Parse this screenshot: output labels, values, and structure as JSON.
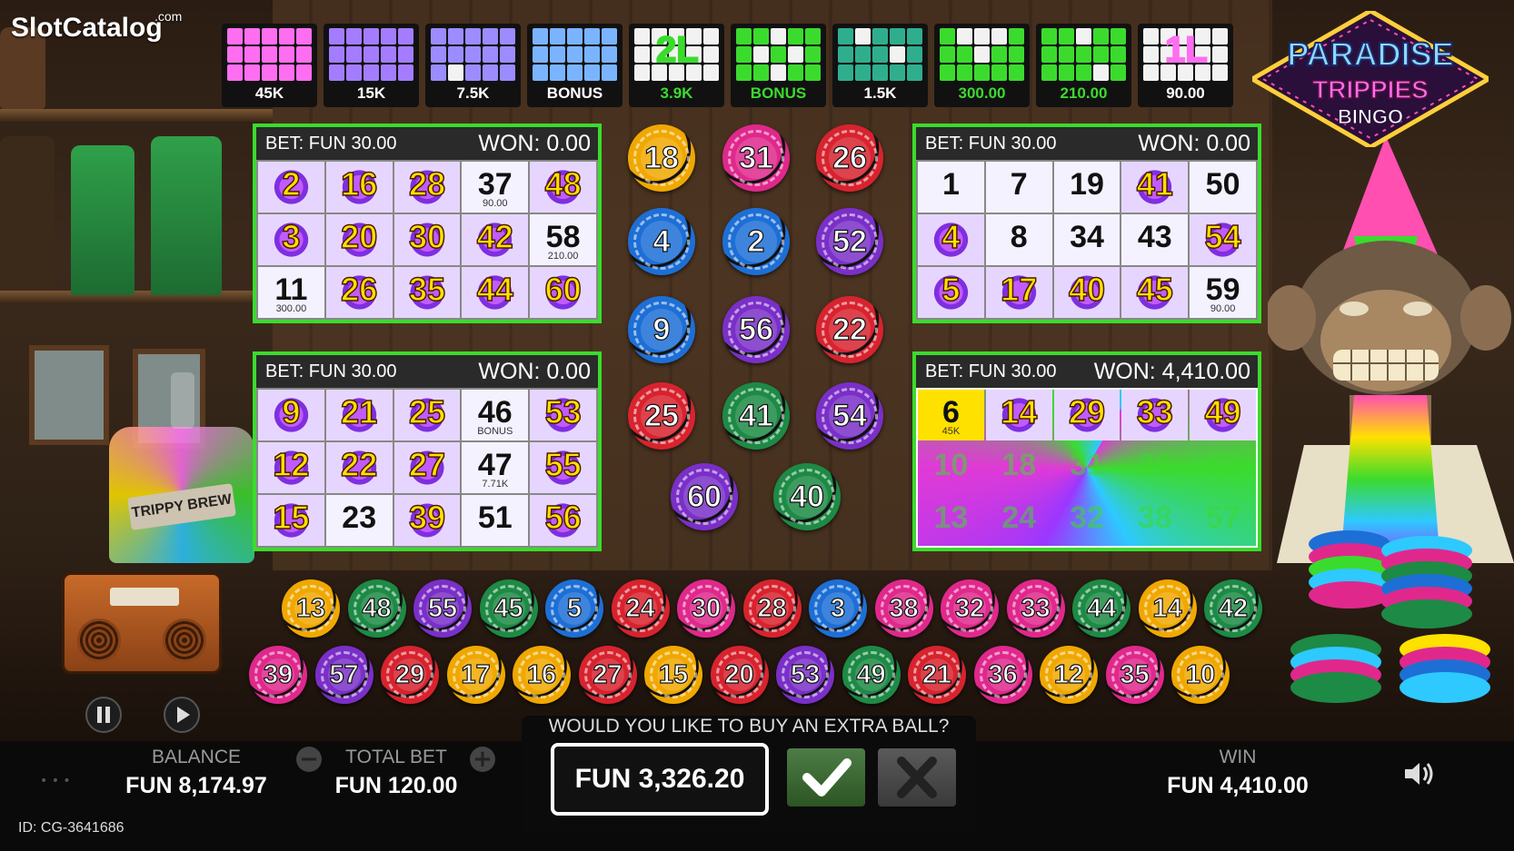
{
  "watermark": {
    "brand": "SlotCatalog",
    "suffix": ".com"
  },
  "game_title": {
    "line1": "PARADISE",
    "line2": "TRIPPIES",
    "line3": "BINGO"
  },
  "paytable": [
    {
      "label": "45K",
      "color": "#ff6ef0",
      "pattern": [
        1,
        1,
        1,
        1,
        1,
        1,
        1,
        1,
        1,
        1,
        1,
        1,
        1,
        1,
        1
      ]
    },
    {
      "label": "15K",
      "color": "#a47cff",
      "pattern": [
        1,
        1,
        1,
        1,
        1,
        1,
        1,
        1,
        1,
        1,
        1,
        1,
        1,
        1,
        1
      ]
    },
    {
      "label": "7.5K",
      "color": "#9b8cff",
      "pattern": [
        1,
        1,
        1,
        1,
        1,
        1,
        1,
        1,
        1,
        1,
        1,
        0,
        1,
        1,
        1
      ]
    },
    {
      "label": "BONUS",
      "color": "#7ab4ff",
      "pattern": [
        1,
        1,
        1,
        1,
        1,
        1,
        1,
        1,
        1,
        1,
        1,
        1,
        1,
        1,
        1
      ]
    },
    {
      "label": "3.9K",
      "color": "#3bdb2d",
      "badge": "2L",
      "pattern": [
        0,
        0,
        0,
        0,
        0,
        0,
        0,
        0,
        0,
        0,
        0,
        0,
        0,
        0,
        0
      ]
    },
    {
      "label": "BONUS",
      "color": "#3bdb2d",
      "pattern": [
        1,
        1,
        0,
        1,
        1,
        1,
        0,
        1,
        0,
        1,
        1,
        1,
        0,
        1,
        1
      ]
    },
    {
      "label": "1.5K",
      "color": "#2fae8e",
      "pattern": [
        1,
        0,
        1,
        1,
        1,
        1,
        1,
        1,
        0,
        1,
        1,
        1,
        1,
        1,
        1
      ]
    },
    {
      "label": "300.00",
      "color": "#3bdb2d",
      "pattern": [
        1,
        0,
        0,
        0,
        1,
        1,
        1,
        0,
        1,
        1,
        1,
        1,
        1,
        1,
        1
      ]
    },
    {
      "label": "210.00",
      "color": "#3bdb2d",
      "pattern": [
        1,
        1,
        0,
        1,
        1,
        1,
        1,
        1,
        1,
        1,
        1,
        1,
        1,
        0,
        1
      ]
    },
    {
      "label": "90.00",
      "color": "#ff6ef0",
      "badge": "1L",
      "pattern": [
        0,
        0,
        0,
        0,
        0,
        0,
        0,
        0,
        0,
        0,
        0,
        0,
        0,
        0,
        0
      ]
    }
  ],
  "cards": [
    {
      "bet": "BET: FUN 30.00",
      "won": "WON: 0.00",
      "cells": [
        {
          "n": "2",
          "hit": true
        },
        {
          "n": "16",
          "hit": true
        },
        {
          "n": "28",
          "hit": true
        },
        {
          "n": "37",
          "sub": "90.00"
        },
        {
          "n": "48",
          "hit": true
        },
        {
          "n": "3",
          "hit": true
        },
        {
          "n": "20",
          "hit": true
        },
        {
          "n": "30",
          "hit": true
        },
        {
          "n": "42",
          "hit": true
        },
        {
          "n": "58",
          "sub": "210.00"
        },
        {
          "n": "11",
          "sub": "300.00"
        },
        {
          "n": "26",
          "hit": true
        },
        {
          "n": "35",
          "hit": true
        },
        {
          "n": "44",
          "hit": true
        },
        {
          "n": "60",
          "hit": true
        }
      ]
    },
    {
      "bet": "BET: FUN 30.00",
      "won": "WON: 0.00",
      "cells": [
        {
          "n": "1"
        },
        {
          "n": "7"
        },
        {
          "n": "19"
        },
        {
          "n": "41",
          "hit": true
        },
        {
          "n": "50"
        },
        {
          "n": "4",
          "hit": true
        },
        {
          "n": "8"
        },
        {
          "n": "34"
        },
        {
          "n": "43"
        },
        {
          "n": "54",
          "hit": true
        },
        {
          "n": "5",
          "hit": true
        },
        {
          "n": "17",
          "hit": true
        },
        {
          "n": "40",
          "hit": true
        },
        {
          "n": "45",
          "hit": true
        },
        {
          "n": "59",
          "sub": "90.00"
        }
      ]
    },
    {
      "bet": "BET: FUN 30.00",
      "won": "WON: 0.00",
      "cells": [
        {
          "n": "9",
          "hit": true
        },
        {
          "n": "21",
          "hit": true
        },
        {
          "n": "25",
          "hit": true
        },
        {
          "n": "46",
          "sub": "BONUS"
        },
        {
          "n": "53",
          "hit": true
        },
        {
          "n": "12",
          "hit": true
        },
        {
          "n": "22",
          "hit": true
        },
        {
          "n": "27",
          "hit": true
        },
        {
          "n": "47",
          "sub": "7.71K"
        },
        {
          "n": "55",
          "hit": true
        },
        {
          "n": "15",
          "hit": true
        },
        {
          "n": "23"
        },
        {
          "n": "39",
          "hit": true
        },
        {
          "n": "51"
        },
        {
          "n": "56",
          "hit": true
        }
      ]
    },
    {
      "bet": "BET: FUN 30.00",
      "won": "WON: 4,410.00",
      "swirl": true,
      "cells": [
        {
          "n": "6",
          "sub": "45K",
          "gold": true
        },
        {
          "n": "14",
          "hit": true
        },
        {
          "n": "29",
          "hit": true
        },
        {
          "n": "33",
          "hit": true
        },
        {
          "n": "49",
          "hit": true
        },
        {
          "n": "10",
          "sw": true
        },
        {
          "n": "18",
          "sw": true
        },
        {
          "n": "31",
          "sw": true
        },
        {
          "n": "36",
          "sw": true
        },
        {
          "n": "52",
          "sw": true
        },
        {
          "n": "13",
          "sw": true
        },
        {
          "n": "24",
          "sw": true
        },
        {
          "n": "32",
          "sw": true
        },
        {
          "n": "38",
          "sw": true
        },
        {
          "n": "57",
          "sw": true
        }
      ]
    }
  ],
  "center_balls": [
    {
      "n": "18",
      "c": "#f0a800"
    },
    {
      "n": "31",
      "c": "#e0288c"
    },
    {
      "n": "26",
      "c": "#d8232e"
    },
    {
      "n": "4",
      "c": "#1d6fd6"
    },
    {
      "n": "2",
      "c": "#1d6fd6"
    },
    {
      "n": "52",
      "c": "#7a2fc8"
    },
    {
      "n": "9",
      "c": "#1d6fd6"
    },
    {
      "n": "56",
      "c": "#7a2fc8"
    },
    {
      "n": "22",
      "c": "#d8232e"
    },
    {
      "n": "25",
      "c": "#d8232e"
    },
    {
      "n": "41",
      "c": "#1d8a45"
    },
    {
      "n": "54",
      "c": "#7a2fc8"
    },
    {
      "n": "60",
      "c": "#7a2fc8"
    },
    {
      "n": "40",
      "c": "#1d8a45"
    }
  ],
  "drawn_row1": [
    {
      "n": "13",
      "c": "#f0a800"
    },
    {
      "n": "48",
      "c": "#1d8a45"
    },
    {
      "n": "55",
      "c": "#7a2fc8"
    },
    {
      "n": "45",
      "c": "#1d8a45"
    },
    {
      "n": "5",
      "c": "#1d6fd6"
    },
    {
      "n": "24",
      "c": "#d8232e"
    },
    {
      "n": "30",
      "c": "#e0288c"
    },
    {
      "n": "28",
      "c": "#d8232e"
    },
    {
      "n": "3",
      "c": "#1d6fd6"
    },
    {
      "n": "38",
      "c": "#e0288c"
    },
    {
      "n": "32",
      "c": "#e0288c"
    },
    {
      "n": "33",
      "c": "#e0288c"
    },
    {
      "n": "44",
      "c": "#1d8a45"
    },
    {
      "n": "14",
      "c": "#f0a800"
    },
    {
      "n": "42",
      "c": "#1d8a45"
    }
  ],
  "drawn_row2": [
    {
      "n": "39",
      "c": "#e0288c"
    },
    {
      "n": "57",
      "c": "#7a2fc8"
    },
    {
      "n": "29",
      "c": "#d8232e"
    },
    {
      "n": "17",
      "c": "#f0a800"
    },
    {
      "n": "16",
      "c": "#f0a800"
    },
    {
      "n": "27",
      "c": "#d8232e"
    },
    {
      "n": "15",
      "c": "#f0a800"
    },
    {
      "n": "20",
      "c": "#d8232e"
    },
    {
      "n": "53",
      "c": "#7a2fc8"
    },
    {
      "n": "49",
      "c": "#1d8a45"
    },
    {
      "n": "21",
      "c": "#d8232e"
    },
    {
      "n": "36",
      "c": "#e0288c"
    },
    {
      "n": "12",
      "c": "#f0a800"
    },
    {
      "n": "35",
      "c": "#e0288c"
    },
    {
      "n": "10",
      "c": "#f0a800"
    }
  ],
  "props": {
    "brew_label": "TRIPPY BREW"
  },
  "footer": {
    "balance_label": "BALANCE",
    "balance_value": "FUN 8,174.97",
    "total_bet_label": "TOTAL BET",
    "total_bet_value": "FUN 120.00",
    "minus": "−",
    "plus": "+",
    "buy_question": "WOULD YOU LIKE TO BUY AN EXTRA BALL?",
    "buy_price": "FUN 3,326.20",
    "win_label": "WIN",
    "win_value": "FUN 4,410.00",
    "id_text": "ID: CG-3641686"
  }
}
